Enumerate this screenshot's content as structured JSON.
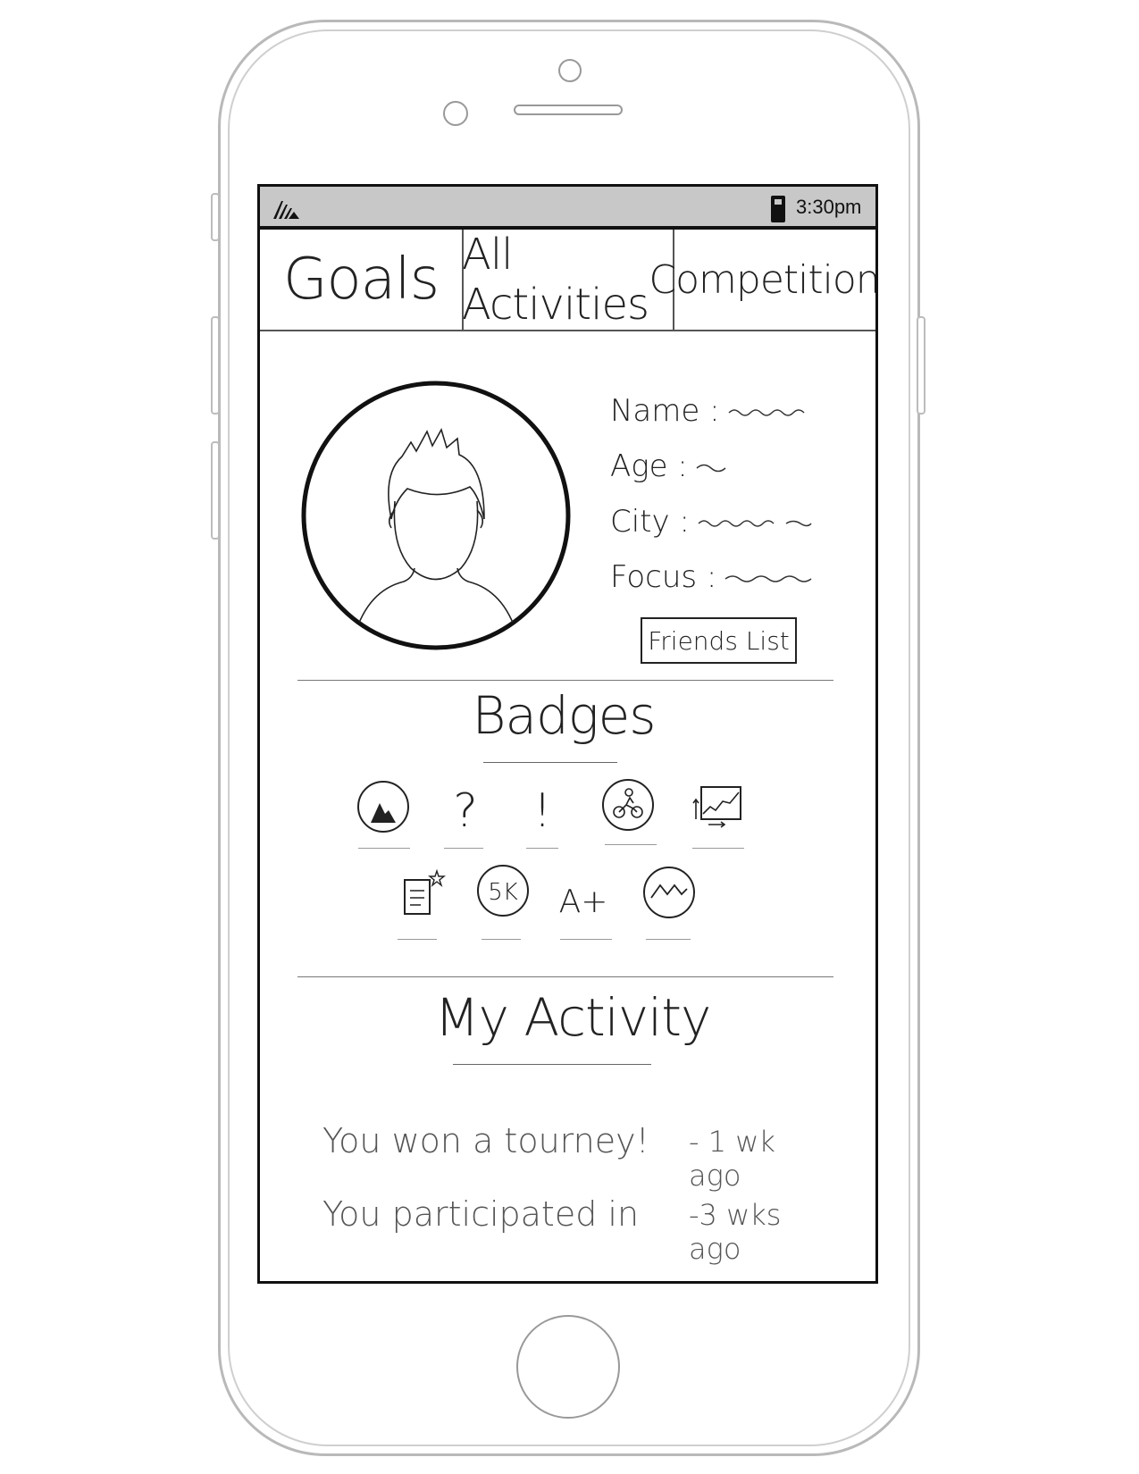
{
  "status_bar": {
    "time": "3:30pm"
  },
  "tabs": [
    {
      "label": "Goals"
    },
    {
      "label": "All Activities"
    },
    {
      "label": "Competitions"
    }
  ],
  "profile": {
    "fields": [
      {
        "label": "Name :"
      },
      {
        "label": "Age :"
      },
      {
        "label": "City :"
      },
      {
        "label": "Focus :"
      }
    ],
    "friends_button": "Friends List"
  },
  "badges": {
    "title": "Badges",
    "items": [
      {
        "icon": "mountain-circle-icon"
      },
      {
        "icon": "question-mark-icon",
        "glyph": "?"
      },
      {
        "icon": "exclamation-icon",
        "glyph": "!"
      },
      {
        "icon": "cyclist-icon"
      },
      {
        "icon": "progress-chart-icon"
      },
      {
        "icon": "document-star-icon"
      },
      {
        "icon": "5k-icon",
        "glyph": "5K"
      },
      {
        "icon": "a-plus-icon",
        "glyph": "A+"
      },
      {
        "icon": "mountains-icon"
      }
    ]
  },
  "activity": {
    "title": "My Activity",
    "items": [
      {
        "text": "You won a tourney!",
        "time": "- 1 wk ago"
      },
      {
        "text": "You participated in",
        "time": "-3 wks ago"
      }
    ]
  }
}
